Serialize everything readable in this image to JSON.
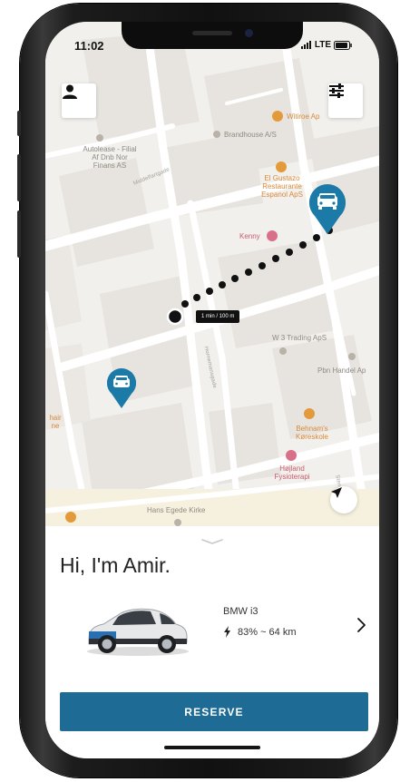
{
  "status_bar": {
    "time": "11:02",
    "network": "LTE"
  },
  "map": {
    "places": [
      {
        "name": "Witiroe Ap",
        "kind": "poi"
      },
      {
        "name": "Brandhouse A/S",
        "kind": "place"
      },
      {
        "name": "Autolease - Filial Af Dnb Nor Finans AS",
        "kind": "place"
      },
      {
        "name": "El Gustazo Restaurante Espanol ApS",
        "kind": "poi"
      },
      {
        "name": "Kenny",
        "kind": "poi"
      },
      {
        "name": "W 3 Trading ApS",
        "kind": "place"
      },
      {
        "name": "Pbn Handel Ap",
        "kind": "place"
      },
      {
        "name": "Behnam's Køreskole",
        "kind": "poi"
      },
      {
        "name": "Højland Fysioterapi",
        "kind": "poi"
      },
      {
        "name": "Hans Egede Kirke",
        "kind": "place"
      },
      {
        "name": "hair ne",
        "kind": "poi"
      }
    ],
    "streets": [
      "Middelfartgade",
      "Hornemansgade",
      "Stengade"
    ],
    "route_info": "1 min / 100 m"
  },
  "sheet": {
    "greeting": "Hi, I'm Amir.",
    "car_name": "BMW i3",
    "battery_range": "83% ~ 64 km",
    "reserve_label": "RESERVE"
  },
  "colors": {
    "accent": "#1e6b95",
    "pin": "#1b7aa8",
    "poi_orange": "#e39a3b",
    "poi_pink": "#d9708a"
  },
  "icons": [
    "user-icon",
    "filter-sliders-icon",
    "car-pin-icon",
    "locate-arrow-icon",
    "battery-charge-icon",
    "chevron-right-icon",
    "grab-handle-icon"
  ]
}
